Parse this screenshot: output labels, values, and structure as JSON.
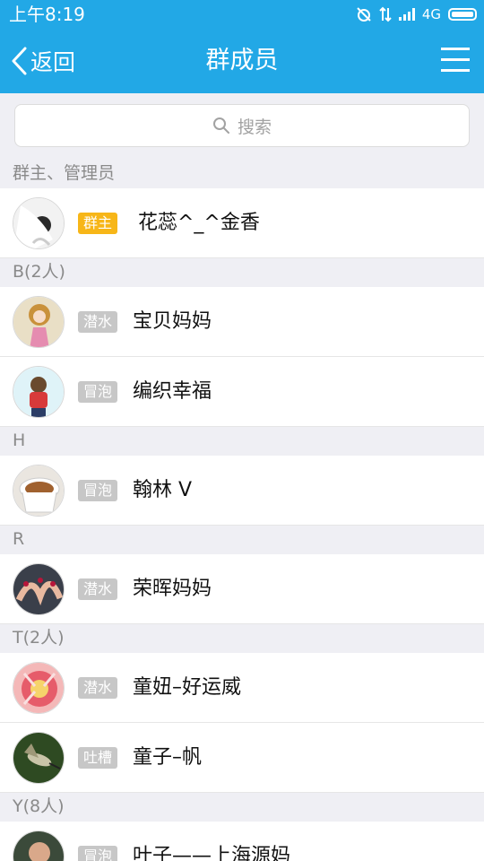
{
  "status_bar": {
    "time": "上午8:19",
    "network": "4G"
  },
  "header": {
    "back_label": "返回",
    "title": "群成员"
  },
  "search": {
    "placeholder": "搜索"
  },
  "sections": [
    {
      "title": "群主、管理员",
      "members": [
        {
          "badge": "群主",
          "badge_type": "owner",
          "name": "花蕊^_^金香"
        }
      ]
    },
    {
      "title": "B(2人)",
      "members": [
        {
          "badge": "潜水",
          "badge_type": "level",
          "name": "宝贝妈妈"
        },
        {
          "badge": "冒泡",
          "badge_type": "level",
          "name": "编织幸福"
        }
      ]
    },
    {
      "title": "H",
      "members": [
        {
          "badge": "冒泡",
          "badge_type": "level",
          "name": "翰林 V"
        }
      ]
    },
    {
      "title": "R",
      "members": [
        {
          "badge": "潜水",
          "badge_type": "level",
          "name": "荣晖妈妈"
        }
      ]
    },
    {
      "title": "T(2人)",
      "members": [
        {
          "badge": "潜水",
          "badge_type": "level",
          "name": "童妞–好运威"
        },
        {
          "badge": "吐槽",
          "badge_type": "level",
          "name": "童子–帆"
        }
      ]
    },
    {
      "title": "Y(8人)",
      "members": [
        {
          "badge": "冒泡",
          "badge_type": "level",
          "name": "叶子——上海源妈"
        }
      ]
    }
  ],
  "colors": {
    "accent": "#22a8e6",
    "owner_badge": "#f7b618",
    "level_badge": "#c7c7c7"
  }
}
